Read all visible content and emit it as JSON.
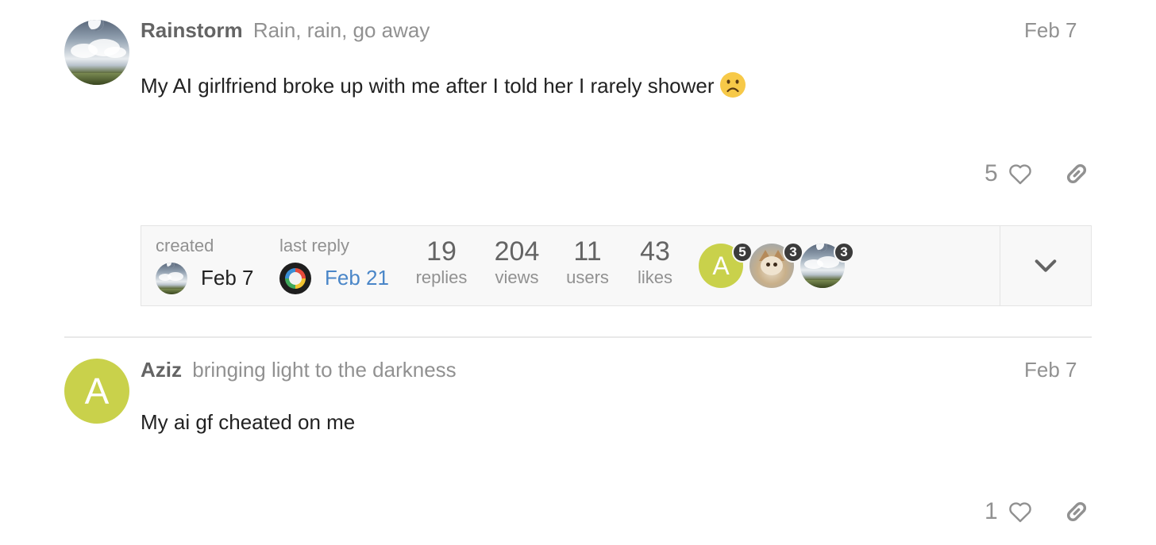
{
  "posts": [
    {
      "username": "Rainstorm",
      "user_title": "Rain, rain, go away",
      "date": "Feb 7",
      "body": "My AI girlfriend broke up with me after I told her I rarely shower",
      "emoji": "frowning-face",
      "likes": "5",
      "avatar": "landscape-sky-avatar"
    },
    {
      "username": "Aziz",
      "user_title": "bringing light to the darkness",
      "date": "Feb 7",
      "body": "My ai gf cheated on me",
      "likes": "1",
      "avatar_letter": "A",
      "avatar_color": "#c9d14b"
    }
  ],
  "topic_map": {
    "created_label": "created",
    "created_date": "Feb 7",
    "last_reply_label": "last reply",
    "last_reply_date": "Feb 21",
    "replies": "19",
    "replies_label": "replies",
    "views": "204",
    "views_label": "views",
    "users": "11",
    "users_label": "users",
    "likes": "43",
    "likes_label": "likes",
    "participants": [
      {
        "letter": "A",
        "count": "5",
        "avatar": "letter-avatar"
      },
      {
        "count": "3",
        "avatar": "cat-avatar"
      },
      {
        "count": "3",
        "avatar": "landscape-sky-avatar"
      }
    ]
  },
  "colors": {
    "link_blue": "#4a86c8",
    "muted_gray": "#919191",
    "avatar_green": "#c9d14b"
  }
}
